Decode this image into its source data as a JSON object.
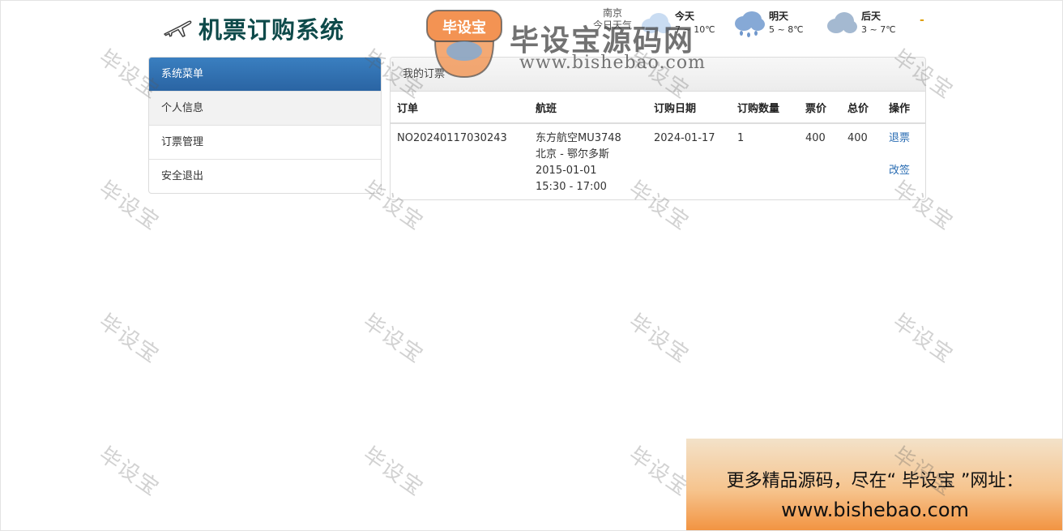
{
  "app": {
    "title": "机票订购系统"
  },
  "weather": {
    "city": "南京",
    "city_sub": "今日天气",
    "days": [
      {
        "name": "今天",
        "temp": "7 ~ 10℃",
        "icon": "cloud-icon"
      },
      {
        "name": "明天",
        "temp": "5 ~ 8℃",
        "icon": "rain-cloud-icon"
      },
      {
        "name": "后天",
        "temp": "3 ~ 7℃",
        "icon": "cloud-icon"
      }
    ],
    "dash": "-"
  },
  "sidebar": {
    "header": "系统菜单",
    "items": [
      {
        "label": "个人信息"
      },
      {
        "label": "订票管理"
      },
      {
        "label": "安全退出"
      }
    ]
  },
  "panel": {
    "heading": "我的订票",
    "columns": [
      "订单",
      "航班",
      "订购日期",
      "订购数量",
      "票价",
      "总价",
      "操作"
    ],
    "rows": [
      {
        "order_no": "NO20240117030243",
        "flight_name": "东方航空MU3748",
        "route": "北京 - 鄂尔多斯",
        "flight_date": "2015-01-01",
        "flight_time": "15:30 - 17:00",
        "order_date": "2024-01-17",
        "quantity": "1",
        "price": "400",
        "total": "400",
        "actions": [
          "退票",
          "改签"
        ]
      }
    ]
  },
  "watermark": {
    "text": "毕设宝",
    "banner_title": "毕设宝源码网",
    "banner_url": "www.bishebao.com",
    "badge_text": "毕设宝"
  },
  "promo": {
    "line1": "更多精品源码，尽在“ 毕设宝 ”网址：",
    "line2": "www.bishebao.com"
  },
  "colors": {
    "title": "#0e4a4a",
    "sidebar_header": "#2a64a3",
    "link": "#2a6db3",
    "weather_dash": "#e0a000"
  }
}
